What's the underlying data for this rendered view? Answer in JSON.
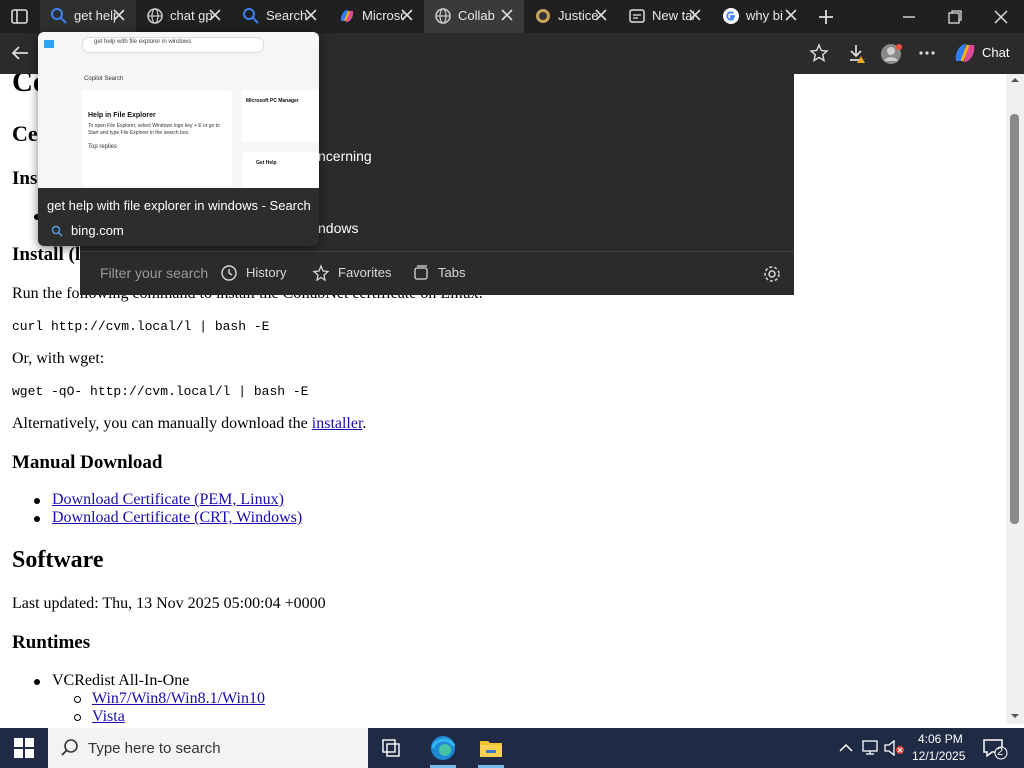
{
  "tabs": [
    {
      "label": "get help with file explorer",
      "icon": "bing-search-icon",
      "active": true
    },
    {
      "label": "chat gpt",
      "icon": "globe-icon"
    },
    {
      "label": "Search",
      "icon": "search-icon"
    },
    {
      "label": "Microsoft",
      "icon": "copilot-icon"
    },
    {
      "label": "Collab",
      "icon": "globe-icon"
    },
    {
      "label": "Justice",
      "icon": "justice-icon"
    },
    {
      "label": "New tab",
      "icon": "newtab-icon"
    },
    {
      "label": "why bi",
      "icon": "google-icon"
    }
  ],
  "toolbar": {
    "chat_label": "Chat"
  },
  "page": {
    "heading_cert": "Ce",
    "heading_top": "Ce",
    "heading_inst": "Inst",
    "install_heading": "Install (l",
    "run_cmd_text": "Run the following command to install the CollabNet certificate on Linux:",
    "curl_cmd": "curl http://cvm.local/l | bash -E",
    "or_wget": "Or, with wget:",
    "wget_cmd": "wget -qO- http://cvm.local/l | bash -E",
    "alt_prefix": "Alternatively, you can manually download the ",
    "alt_link": "installer",
    "alt_suffix": ".",
    "manual_heading": "Manual Download",
    "dl_pem": "Download Certificate (PEM, Linux)",
    "dl_crt": "Download Certificate (CRT, Windows)",
    "software_heading": "Software",
    "last_updated": "Last updated: Thu, 13 Nov 2025 05:00:04 +0000",
    "runtimes_heading": "Runtimes",
    "vcredist": "VCRedist All-In-One",
    "win7": "Win7/Win8/Win8.1/Win10",
    "vista": "Vista"
  },
  "dropdown": {
    "row1": "ncerning",
    "row2": "ndows",
    "filter_placeholder": "Filter your search",
    "history_label": "History",
    "favorites_label": "Favorites",
    "tabs_label": "Tabs"
  },
  "preview": {
    "title": "get help with file explorer in windows - Search",
    "domain": "bing.com",
    "thumb": {
      "search_text": "get help with file explorer in windows",
      "card_header": "Copilot Search",
      "answer_title": "Help in File Explorer",
      "answer_text": "To open File Explorer, select Windows logo key + E or go to Start and type File Explorer in the search box.",
      "tips": "Top replies",
      "pc_manager": "Microsoft PC Manager",
      "get_help": "Get Help"
    }
  },
  "taskbar": {
    "search_placeholder": "Type here to search",
    "time": "4:06 PM",
    "date": "12/1/2025",
    "notification_count": "2"
  }
}
